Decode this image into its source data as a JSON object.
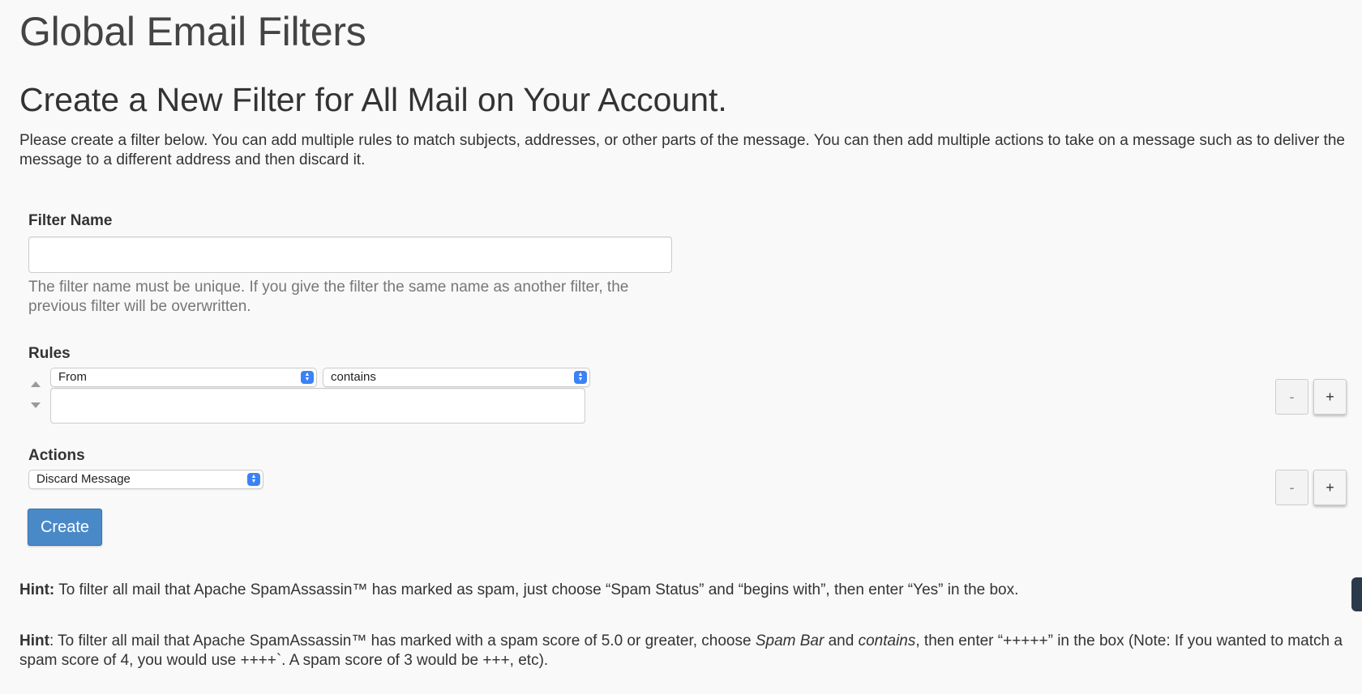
{
  "page": {
    "title": "Global Email Filters",
    "section_title": "Create a New Filter for All Mail on Your Account.",
    "intro": "Please create a filter below. You can add multiple rules to match subjects, addresses, or other parts of the message. You can then add multiple actions to take on a message such as to deliver the message to a different address and then discard it."
  },
  "filter_name": {
    "label": "Filter Name",
    "value": "",
    "help": "The filter name must be unique. If you give the filter the same name as another filter, the previous filter will be overwritten."
  },
  "rules": {
    "label": "Rules",
    "field_select": "From",
    "operator_select": "contains",
    "value": "",
    "remove_label": "-",
    "add_label": "+"
  },
  "actions": {
    "label": "Actions",
    "action_select": "Discard Message",
    "remove_label": "-",
    "add_label": "+"
  },
  "create_button": "Create",
  "hints": [
    {
      "prefix": "Hint:",
      "text": " To filter all mail that Apache SpamAssassin™ has marked as spam, just choose “Spam Status” and “begins with”, then enter “Yes” in the box."
    },
    {
      "prefix": "Hint",
      "text_a": ": To filter all mail that Apache SpamAssassin™ has marked with a spam score of 5.0 or greater, choose ",
      "em_a": "Spam Bar",
      "text_b": " and ",
      "em_b": "contains",
      "text_c": ", then enter “+++++” in the box (Note: If you wanted to match a spam score of 4, you would use ++++`. A spam score of 3 would be +++, etc)."
    }
  ],
  "colors": {
    "background": "#f9f9f9",
    "primary_button": "#4a89c8",
    "select_caret": "#3b82f6"
  }
}
